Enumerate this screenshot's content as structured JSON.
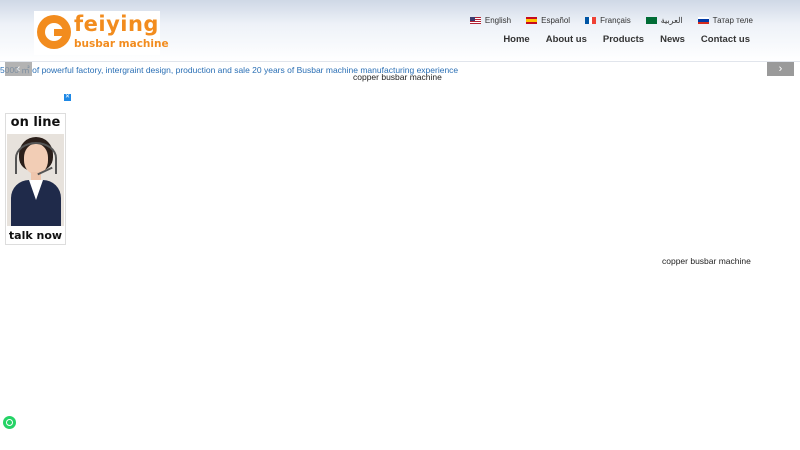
{
  "logo": {
    "line1": "feiying",
    "line2": "busbar machine"
  },
  "languages": [
    {
      "label": "English",
      "flag": "us-flag-icon"
    },
    {
      "label": "Español",
      "flag": "spain-flag-icon"
    },
    {
      "label": "Français",
      "flag": "france-flag-icon"
    },
    {
      "label": "العربية",
      "flag": "saudi-flag-icon"
    },
    {
      "label": "Татар теле",
      "flag": "russia-flag-icon"
    }
  ],
  "nav": [
    "Home",
    "About us",
    "Products",
    "News",
    "Contact us"
  ],
  "marquee": "5000 ㎡ of powerful factory, intergraint design, production and sale 20 years of Busbar machine manufacturing experience",
  "captions": {
    "top": "copper busbar machine",
    "right": "copper busbar machine"
  },
  "chat": {
    "top": "on line",
    "bottom": "talk now",
    "close": "✕"
  },
  "arrows": {
    "left": "‹",
    "right": "›"
  },
  "colors": {
    "accent": "#f28c1e",
    "link": "#2a6fb5",
    "whatsapp": "#25d366"
  }
}
